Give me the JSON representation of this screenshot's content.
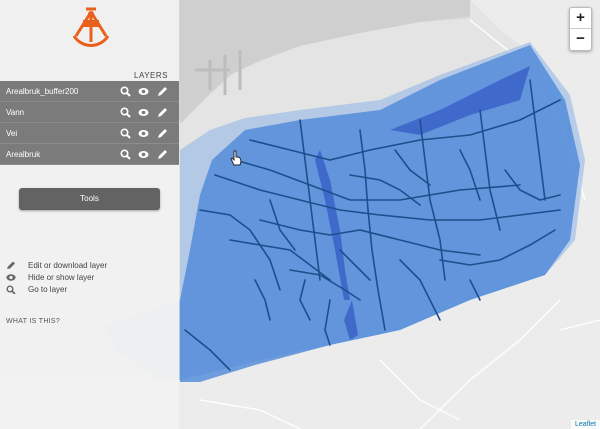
{
  "sidebar": {
    "layers_title": "LAYERS",
    "layers": [
      {
        "name": "Arealbruk_buffer200"
      },
      {
        "name": "Vann"
      },
      {
        "name": "Vei"
      },
      {
        "name": "Arealbruk"
      }
    ],
    "tools_label": "Tools",
    "legend": [
      {
        "icon": "pencil-icon",
        "label": "Edit or download layer"
      },
      {
        "icon": "eye-icon",
        "label": "Hide or show layer"
      },
      {
        "icon": "search-icon",
        "label": "Go to layer"
      }
    ],
    "what_is_this": "WHAT IS THIS?"
  },
  "map": {
    "zoom_in": "+",
    "zoom_out": "−",
    "attribution": "Leaflet",
    "colors": {
      "buffer": "#4a86d8",
      "water": "#3a63c8",
      "road": "#1c4f8c",
      "land": "#d9d9d9",
      "sea": "#f0f0f0"
    }
  },
  "logo": {
    "icon": "sextant-icon",
    "color": "#e8601c"
  }
}
